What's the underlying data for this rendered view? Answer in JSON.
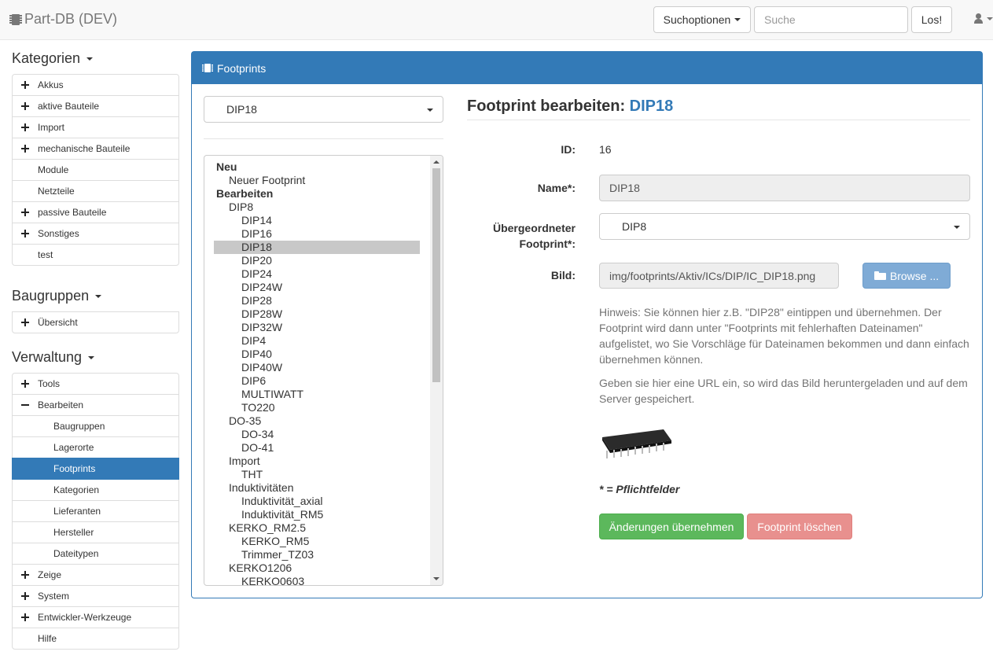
{
  "navbar": {
    "brand": "Part-DB (DEV)",
    "search_options_label": "Suchoptionen",
    "search_placeholder": "Suche",
    "search_value": "",
    "go_label": "Los!"
  },
  "sidebar": {
    "categories_title": "Kategorien",
    "categories": [
      {
        "label": "Akkus",
        "expandable": true
      },
      {
        "label": "aktive Bauteile",
        "expandable": true
      },
      {
        "label": "Import",
        "expandable": true
      },
      {
        "label": "mechanische Bauteile",
        "expandable": true
      },
      {
        "label": "Module",
        "expandable": false
      },
      {
        "label": "Netzteile",
        "expandable": false
      },
      {
        "label": "passive Bauteile",
        "expandable": true
      },
      {
        "label": "Sonstiges",
        "expandable": true
      },
      {
        "label": "test",
        "expandable": false
      }
    ],
    "groups_title": "Baugruppen",
    "groups": [
      {
        "label": "Übersicht",
        "expandable": true
      }
    ],
    "admin_title": "Verwaltung",
    "admin": [
      {
        "label": "Tools",
        "state": "plus"
      },
      {
        "label": "Bearbeiten",
        "state": "minus"
      },
      {
        "label": "Baugruppen",
        "state": "sub"
      },
      {
        "label": "Lagerorte",
        "state": "sub"
      },
      {
        "label": "Footprints",
        "state": "sub-active"
      },
      {
        "label": "Kategorien",
        "state": "sub"
      },
      {
        "label": "Lieferanten",
        "state": "sub"
      },
      {
        "label": "Hersteller",
        "state": "sub"
      },
      {
        "label": "Dateitypen",
        "state": "sub"
      },
      {
        "label": "Zeige",
        "state": "plus"
      },
      {
        "label": "System",
        "state": "plus"
      },
      {
        "label": "Entwickler-Werkzeuge",
        "state": "plus"
      },
      {
        "label": "Hilfe",
        "state": "none"
      }
    ]
  },
  "panel": {
    "heading": "Footprints",
    "selected_footprint": "DIP18",
    "tree": [
      {
        "label": "Neu",
        "level": 0,
        "bold": true
      },
      {
        "label": "Neuer Footprint",
        "level": 1
      },
      {
        "label": "Bearbeiten",
        "level": 0,
        "bold": true
      },
      {
        "label": "DIP8",
        "level": 1
      },
      {
        "label": "DIP14",
        "level": 2
      },
      {
        "label": "DIP16",
        "level": 2
      },
      {
        "label": "DIP18",
        "level": 2,
        "selected": true
      },
      {
        "label": "DIP20",
        "level": 2
      },
      {
        "label": "DIP24",
        "level": 2
      },
      {
        "label": "DIP24W",
        "level": 2
      },
      {
        "label": "DIP28",
        "level": 2
      },
      {
        "label": "DIP28W",
        "level": 2
      },
      {
        "label": "DIP32W",
        "level": 2
      },
      {
        "label": "DIP4",
        "level": 2
      },
      {
        "label": "DIP40",
        "level": 2
      },
      {
        "label": "DIP40W",
        "level": 2
      },
      {
        "label": "DIP6",
        "level": 2
      },
      {
        "label": "MULTIWATT",
        "level": 2
      },
      {
        "label": "TO220",
        "level": 2
      },
      {
        "label": "DO-35",
        "level": 1
      },
      {
        "label": "DO-34",
        "level": 2
      },
      {
        "label": "DO-41",
        "level": 2
      },
      {
        "label": "Import",
        "level": 1
      },
      {
        "label": "THT",
        "level": 2
      },
      {
        "label": "Induktivitäten",
        "level": 1
      },
      {
        "label": "Induktivität_axial",
        "level": 2
      },
      {
        "label": "Induktivität_RM5",
        "level": 2
      },
      {
        "label": "KERKO_RM2.5",
        "level": 1
      },
      {
        "label": "KERKO_RM5",
        "level": 2
      },
      {
        "label": "Trimmer_TZ03",
        "level": 2
      },
      {
        "label": "KERKO1206",
        "level": 1
      },
      {
        "label": "KERKO0603",
        "level": 2
      }
    ],
    "form": {
      "title_prefix": "Footprint bearbeiten:",
      "title_name": "DIP18",
      "id_label": "ID:",
      "id_value": "16",
      "name_label": "Name*:",
      "name_value": "DIP18",
      "parent_label_line1": "Übergeordneter",
      "parent_label_line2": "Footprint*:",
      "parent_value": "DIP8",
      "image_label": "Bild:",
      "image_value": "img/footprints/Aktiv/ICs/DIP/IC_DIP18.png",
      "browse_label": "Browse ...",
      "hint1": "Hinweis: Sie können hier z.B. \"DIP28\" eintippen und übernehmen. Der Footprint wird dann unter \"Footprints mit fehlerhaften Dateinamen\" aufgelistet, wo Sie Vorschläge für Dateinamen bekommen und dann einfach übernehmen können.",
      "hint2": "Geben sie hier eine URL ein, so wird das Bild heruntergeladen und auf dem Server gespeichert.",
      "required_note": "* = Pflichtfelder",
      "save_label": "Änderungen übernehmen",
      "delete_label": "Footprint löschen"
    }
  },
  "colors": {
    "primary": "#337ab7",
    "success": "#5cb85c",
    "danger_disabled": "#e8908e"
  }
}
